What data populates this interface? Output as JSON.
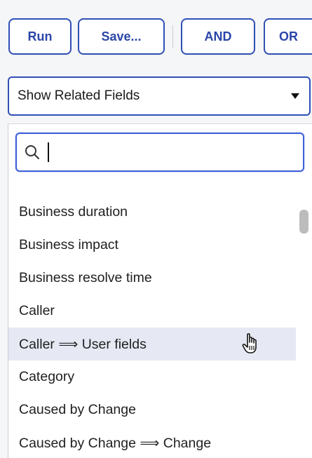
{
  "toolbar": {
    "buttons": [
      {
        "label": "Run"
      },
      {
        "label": "Save..."
      },
      {
        "label": "AND"
      },
      {
        "label": "OR"
      }
    ]
  },
  "select": {
    "value": "Show Related Fields",
    "icon": "chevron-down-icon"
  },
  "search": {
    "value": "",
    "placeholder": "",
    "icon": "search-icon"
  },
  "list": {
    "items": [
      {
        "label": "Business duration"
      },
      {
        "label": "Business impact"
      },
      {
        "label": "Business resolve time"
      },
      {
        "label": "Caller"
      },
      {
        "label": "Caller ⟹ User fields"
      },
      {
        "label": "Category"
      },
      {
        "label": "Caused by Change"
      },
      {
        "label": "Caused by Change ⟹ Change"
      }
    ],
    "hovered_index": 4
  },
  "colors": {
    "accent": "#2f4fb6",
    "hover_bg": "#e6e9f4",
    "scroll_thumb": "#bcbcbc"
  }
}
